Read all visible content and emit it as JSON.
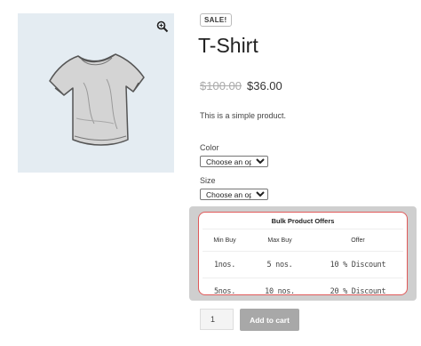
{
  "gallery": {
    "zoom_icon": "magnifier-zoom-icon",
    "image_subject": "t-shirt",
    "background_color": "#e4ecf2"
  },
  "product": {
    "badge": "SALE!",
    "title": "T-Shirt",
    "old_price": "$100.00",
    "price": "$36.00",
    "description": "This is a simple product."
  },
  "variations": {
    "color": {
      "label": "Color",
      "selected": "Choose an option"
    },
    "size": {
      "label": "Size",
      "selected": "Choose an option"
    }
  },
  "bulk_offers": {
    "title": "Bulk Product Offers",
    "border_color": "#e05a5a",
    "headers": {
      "min": "Min Buy",
      "max": "Max Buy",
      "offer": "Offer"
    },
    "rows": [
      {
        "min": "1nos.",
        "max": "5 nos.",
        "offer": "10 % Discount"
      },
      {
        "min": "5nos.",
        "max": "10 nos.",
        "offer": "20 % Discount"
      }
    ]
  },
  "cart": {
    "quantity": "1",
    "button_label": "Add to cart",
    "button_color": "#a8a8a8"
  }
}
